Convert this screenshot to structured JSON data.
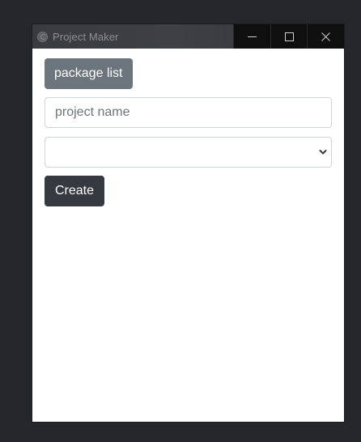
{
  "window": {
    "title": "Project Maker",
    "controls": {
      "minimize_icon": "minimize-icon",
      "maximize_icon": "maximize-icon",
      "close_icon": "close-icon"
    }
  },
  "form": {
    "package_list_label": "package list",
    "project_name": {
      "value": "",
      "placeholder": "project name"
    },
    "package_select": {
      "selected": ""
    },
    "create_label": "Create"
  },
  "colors": {
    "secondary_button": "#6c757d",
    "dark_button": "#343a40",
    "desktop": "#26272b"
  }
}
